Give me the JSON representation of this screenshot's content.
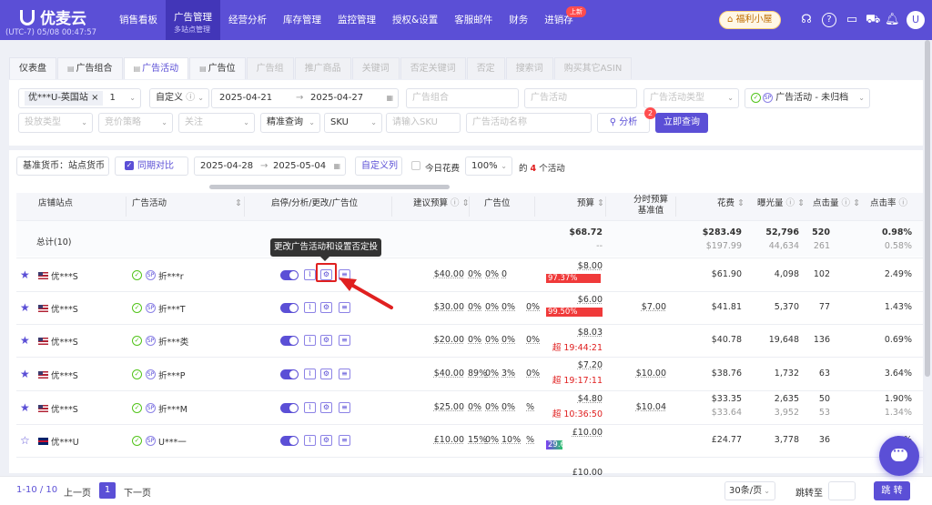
{
  "header": {
    "brand": "优麦云",
    "clock": "(UTC-7) 05/08 00:47:57",
    "menu": [
      "销售看板",
      "广告管理",
      "经营分析",
      "库存管理",
      "监控管理",
      "授权&设置",
      "客服邮件",
      "财务",
      "进销存"
    ],
    "active_sub": "多站点管理",
    "new_badge": "上新",
    "welfare": "福利小屋",
    "avatar_initial": "U",
    "accent_color": "#5b4fd6"
  },
  "tabs": [
    {
      "label": "仪表盘",
      "state": "normal"
    },
    {
      "label": "广告组合",
      "state": "normal"
    },
    {
      "label": "广告活动",
      "state": "active"
    },
    {
      "label": "广告位",
      "state": "normal"
    },
    {
      "label": "广告组",
      "state": "disabled"
    },
    {
      "label": "推广商品",
      "state": "disabled"
    },
    {
      "label": "关键词",
      "state": "disabled"
    },
    {
      "label": "否定关键词",
      "state": "disabled"
    },
    {
      "label": "否定",
      "state": "disabled"
    },
    {
      "label": "搜索词",
      "state": "disabled"
    },
    {
      "label": "购买其它ASIN",
      "state": "disabled"
    }
  ],
  "filters": {
    "store_chip": "优***U-英国站",
    "store_count": "1",
    "date_mode": "自定义",
    "date_start": "2025-04-21",
    "date_end": "2025-04-27",
    "ad_group_ph": "广告组合",
    "campaign_ph": "广告活动",
    "campaign_type_ph": "广告活动类型",
    "status_select": "广告活动 - 未归档",
    "ad_type_ph": "投放类型",
    "bid_strategy_ph": "竞价策略",
    "follow_ph": "关注",
    "query_mode": "精准查询",
    "sku_select": "SKU",
    "sku_ph": "请输入SKU",
    "campaign_name_ph": "广告活动名称",
    "analyze_button": "分析",
    "analyze_badge": "2",
    "query_button": "立即查询"
  },
  "toolbar": {
    "currency": "基准货币：站点货币",
    "compare": "同期对比",
    "cmp_start": "2025-04-28",
    "cmp_end": "2025-05-04",
    "custom_columns": "自定义列",
    "today_spend": "今日花费",
    "zoom": "100%",
    "count_prefix": "的",
    "count": "4",
    "count_suffix": "个活动"
  },
  "columns": {
    "store": "店铺站点",
    "campaign": "广告活动",
    "actions": "启停/分析/更改/广告位",
    "suggested_budget": "建议预算",
    "placement": "广告位",
    "budget": "预算",
    "hourly_budget": "分时预算",
    "baseline": "基准值",
    "spend": "花费",
    "impressions": "曝光量",
    "clicks": "点击量",
    "ctr": "点击率"
  },
  "summary": {
    "label": "总计(10)",
    "budget": "$68.72",
    "budget_cmp": "--",
    "spend": "$283.49",
    "spend_cmp": "$197.99",
    "impressions": "52,796",
    "impressions_cmp": "44,634",
    "clicks": "520",
    "clicks_cmp": "261",
    "ctr": "0.98%",
    "ctr_cmp": "0.58%"
  },
  "tooltip": "更改广告活动和设置否定投放",
  "rows": [
    {
      "store": "优***S",
      "country": "us",
      "campaign": "折***r",
      "suggested": "$40.00",
      "placement": [
        "0%",
        "0%",
        "0"
      ],
      "budget": "$8.00",
      "budget_note": "97.37%",
      "note_style": "red-bar",
      "note_fill": 0.9737,
      "hourly": "",
      "spend": "$61.90",
      "spend_cmp": "",
      "impressions": "4,098",
      "impressions_cmp": "",
      "clicks": "102",
      "clicks_cmp": "",
      "ctr": "2.49%",
      "ctr_cmp": "",
      "starred": true
    },
    {
      "store": "优***S",
      "country": "us",
      "campaign": "折***T",
      "suggested": "$30.00",
      "placement": [
        "0%",
        "0%",
        "0%",
        "0%"
      ],
      "budget": "$6.00",
      "budget_note": "99.50%",
      "note_style": "red-bar",
      "note_fill": 0.995,
      "hourly": "$7.00",
      "spend": "$41.81",
      "spend_cmp": "",
      "impressions": "5,370",
      "impressions_cmp": "",
      "clicks": "77",
      "clicks_cmp": "",
      "ctr": "1.43%",
      "ctr_cmp": "",
      "starred": true
    },
    {
      "store": "优***S",
      "country": "us",
      "campaign": "折***类",
      "suggested": "$20.00",
      "placement": [
        "0%",
        "0%",
        "0%",
        "0%"
      ],
      "budget": "$8.03",
      "budget_note": "超 19:44:21",
      "note_style": "red-text",
      "hourly": "",
      "spend": "$40.78",
      "spend_cmp": "",
      "impressions": "19,648",
      "impressions_cmp": "",
      "clicks": "136",
      "clicks_cmp": "",
      "ctr": "0.69%",
      "ctr_cmp": "",
      "starred": true
    },
    {
      "store": "优***S",
      "country": "us",
      "campaign": "折***P",
      "suggested": "$40.00",
      "placement": [
        "89%",
        "0%",
        "3%",
        "0%"
      ],
      "budget": "$7.20",
      "budget_note": "超 19:17:11",
      "note_style": "red-text",
      "hourly": "$10.00",
      "spend": "$38.76",
      "spend_cmp": "",
      "impressions": "1,732",
      "impressions_cmp": "",
      "clicks": "63",
      "clicks_cmp": "",
      "ctr": "3.64%",
      "ctr_cmp": "",
      "starred": true
    },
    {
      "store": "优***S",
      "country": "us",
      "campaign": "折***M",
      "suggested": "$25.00",
      "placement": [
        "0%",
        "0%",
        "0%",
        "%"
      ],
      "budget": "$4.80",
      "budget_note": "超 10:36:50",
      "note_style": "red-text",
      "hourly": "$10.04",
      "spend": "$33.35",
      "spend_cmp": "$33.64",
      "impressions": "2,635",
      "impressions_cmp": "3,952",
      "clicks": "50",
      "clicks_cmp": "53",
      "ctr": "1.90%",
      "ctr_cmp": "1.34%",
      "starred": true
    },
    {
      "store": "优***U",
      "country": "gb",
      "campaign": "U***一",
      "suggested": "£10.00",
      "placement": [
        "15%",
        "0%",
        "10%",
        "%"
      ],
      "budget": "£10.00",
      "budget_note": "29.60%",
      "note_style": "purple-bar",
      "note_fill": 0.296,
      "hourly": "",
      "spend": "£24.77",
      "spend_cmp": "",
      "impressions": "3,778",
      "impressions_cmp": "",
      "clicks": "36",
      "clicks_cmp": "",
      "ctr": "0.%",
      "ctr_cmp": "",
      "starred": false
    },
    {
      "store": "",
      "country": "",
      "campaign": "",
      "suggested": "",
      "placement": [],
      "budget": "£10.00",
      "budget_note": "",
      "note_style": "",
      "hourly": "",
      "spend": "",
      "spend_cmp": "",
      "impressions": "",
      "impressions_cmp": "",
      "clicks": "",
      "clicks_cmp": "",
      "ctr": "",
      "ctr_cmp": "",
      "starred": false
    }
  ],
  "footer": {
    "range": "1-10 / 10",
    "prev": "上一页",
    "page": "1",
    "next": "下一页",
    "page_size": "30条/页",
    "jump_label": "跳转至",
    "jump_button": "跳 转"
  }
}
